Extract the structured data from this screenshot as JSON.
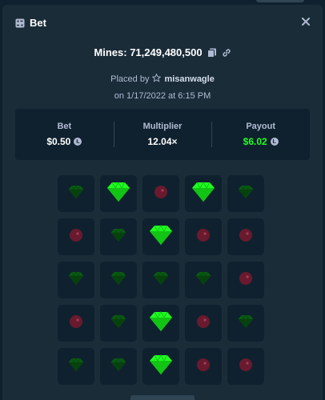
{
  "modal": {
    "title": "Bet",
    "close_icon": "close-icon",
    "header_icon": "dice-icon"
  },
  "bet_info": {
    "mines_label": "Mines:",
    "bet_id": "71,249,480,500",
    "copy_icon": "copy-icon",
    "link_icon": "link-icon",
    "placed_by_label": "Placed by",
    "user_icon": "star-icon",
    "username": "misanwagle",
    "date_text": "on 1/17/2022 at 6:15 PM"
  },
  "stats": {
    "bet_label": "Bet",
    "bet_value": "$0.50",
    "multiplier_label": "Multiplier",
    "multiplier_value": "12.04×",
    "payout_label": "Payout",
    "payout_value": "$6.02",
    "currency_icon": "litecoin-icon"
  },
  "colors": {
    "background": "#0f212e",
    "panel": "#1a2c38",
    "gem_revealed": "#1fff20",
    "gem_dim": "#0a5c14",
    "mine_dim": "#6a1a2e"
  },
  "board": {
    "rows": [
      [
        "gem",
        "gem-revealed",
        "mine",
        "gem-revealed",
        "gem"
      ],
      [
        "mine",
        "gem",
        "gem-revealed",
        "mine",
        "mine"
      ],
      [
        "gem",
        "gem",
        "gem",
        "gem",
        "mine"
      ],
      [
        "mine",
        "gem",
        "gem-revealed",
        "mine",
        "gem"
      ],
      [
        "gem",
        "gem",
        "gem-revealed",
        "mine",
        "mine"
      ]
    ]
  }
}
